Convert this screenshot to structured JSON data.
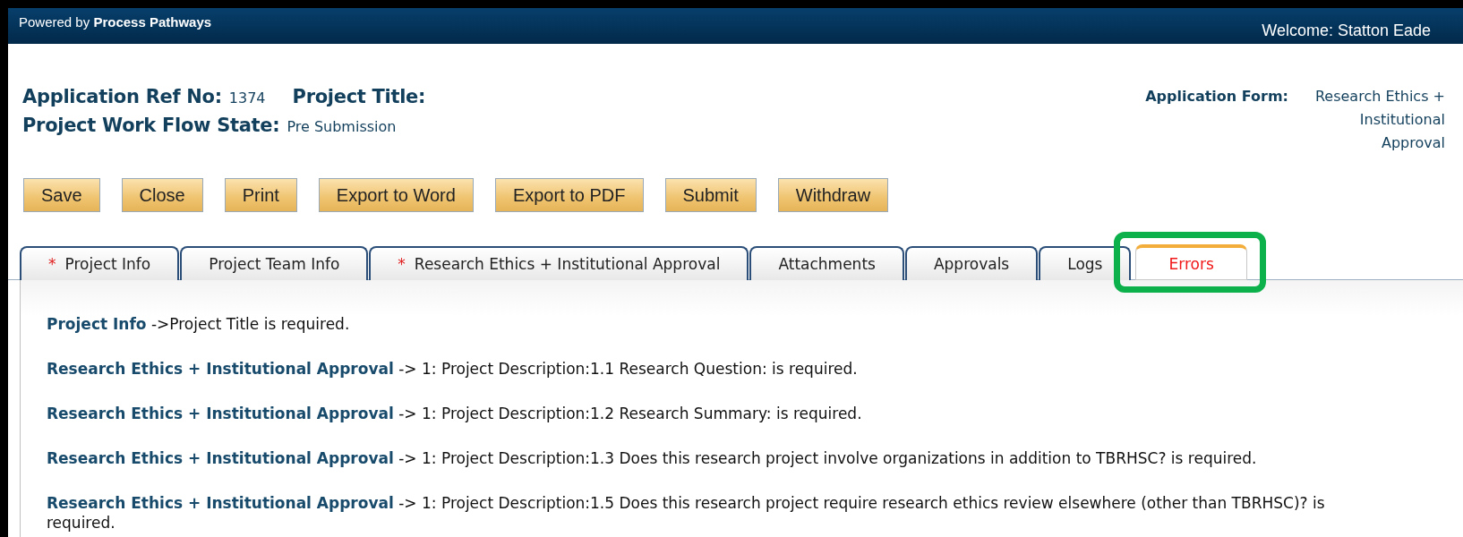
{
  "header": {
    "powered_by": "Powered by **Process Pathways**",
    "welcome": "Welcome: Statton Eade"
  },
  "application": {
    "ref_label": "Application Ref No:",
    "ref_value": "1374",
    "title_label": "Project Title:",
    "state_label": "Project Work Flow State:",
    "state_value": "Pre Submission",
    "form_label": "Application Form:",
    "form_value": "Research Ethics + Institutional Approval"
  },
  "buttons": [
    "Save",
    "Close",
    "Print",
    "Export to Word",
    "Export to PDF",
    "Submit",
    "Withdraw"
  ],
  "tabs": [
    {
      "label": "Project Info",
      "required": true,
      "selected": false,
      "highlighted": false
    },
    {
      "label": "Project Team Info",
      "required": false,
      "selected": false,
      "highlighted": false
    },
    {
      "label": "Research Ethics + Institutional Approval",
      "required": true,
      "selected": false,
      "highlighted": false
    },
    {
      "label": "Attachments",
      "required": false,
      "selected": false,
      "highlighted": false
    },
    {
      "label": "Approvals",
      "required": false,
      "selected": false,
      "highlighted": false
    },
    {
      "label": "Logs",
      "required": false,
      "selected": false,
      "highlighted": false
    },
    {
      "label": "Errors",
      "required": false,
      "selected": true,
      "highlighted": true
    }
  ],
  "required_mark": "*",
  "errors": [
    "**Project Info** ->Project Title is required.",
    "**Research Ethics + Institutional Approval** -> 1: Project Description:1.1 Research Question: is required.",
    "**Research Ethics + Institutional Approval** -> 1: Project Description:1.2 Research Summary: is required.",
    "**Research Ethics + Institutional Approval** -> 1: Project Description:1.3 Does this research project involve organizations in addition to TBRHSC? is required.",
    "**Research Ethics + Institutional Approval** -> 1: Project Description:1.5 Does this research project require research ethics review elsewhere (other than TBRHSC)? is required."
  ]
}
